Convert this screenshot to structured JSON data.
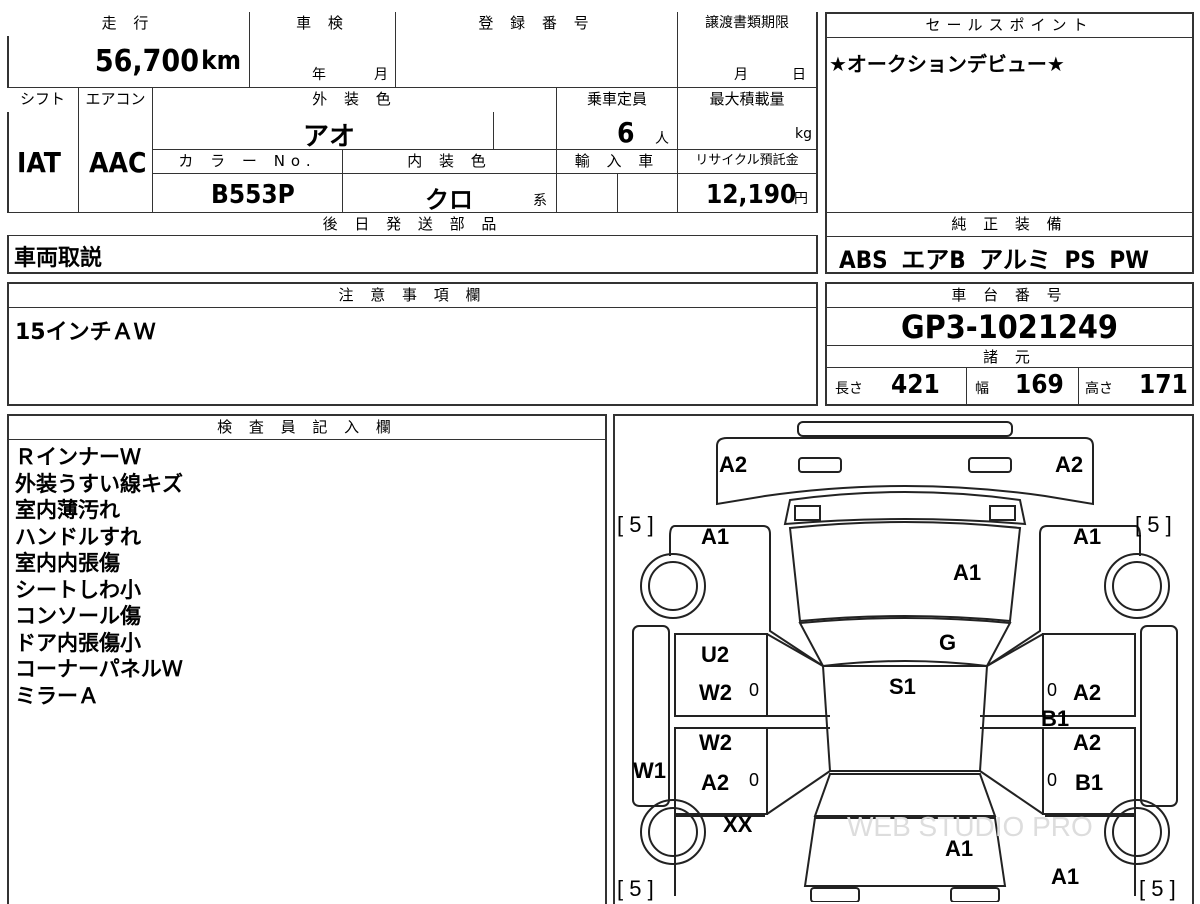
{
  "top": {
    "mileage_label": "走 行",
    "mileage_value": "56,700",
    "mileage_unit": "km",
    "shaken_label": "車 検",
    "shaken_year": "年",
    "shaken_month": "月",
    "reg_label": "登 録 番 号",
    "transfer_label": "譲渡書類期限",
    "transfer_month": "月",
    "transfer_day": "日",
    "shift_label": "シフト",
    "shift_value": "IAT",
    "ac_label": "エアコン",
    "ac_value": "AAC",
    "exterior_label": "外 装 色",
    "exterior_value": "アオ",
    "capacity_label": "乗車定員",
    "capacity_value": "6",
    "capacity_unit": "人",
    "maxload_label": "最大積載量",
    "maxload_unit": "kg",
    "color_no_label": "カ ラ ー No.",
    "color_no_value": "B553P",
    "interior_label": "内 装 色",
    "interior_value": "クロ",
    "interior_suffix": "系",
    "import_label": "輸 入 車",
    "recycle_label": "リサイクル預託金",
    "recycle_value": "12,190",
    "recycle_unit": "円",
    "later_parts_label": "後 日 発 送 部 品",
    "later_parts_value": "車両取説"
  },
  "sales": {
    "label": "セールスポイント",
    "value": "★オークションデビュー★"
  },
  "equipment": {
    "label": "純 正 装 備",
    "value": "ABS エアB アルミ PS PW"
  },
  "notes": {
    "label": "注 意 事 項 欄",
    "value": "15インチＡＷ"
  },
  "chassis": {
    "label": "車 台 番 号",
    "value": "GP3-1021249"
  },
  "specs": {
    "label": "諸 元",
    "length_label": "長さ",
    "length_value": "421",
    "width_label": "幅",
    "width_value": "169",
    "height_label": "高さ",
    "height_value": "171"
  },
  "inspector": {
    "label": "検 査 員 記 入 欄",
    "lines": [
      "ＲインナーＷ",
      "外装うすい線キズ",
      "室内薄汚れ",
      "ハンドルすれ",
      "室内内張傷",
      "シートしわ小",
      "コンソール傷",
      "ドア内張傷小",
      "コーナーパネルＷ",
      "ミラーＡ"
    ]
  },
  "diagram": {
    "tire_left_top": "[ 5 ]",
    "tire_right_top": "[ 5 ]",
    "tire_left_bottom": "[ 5 ]",
    "tire_right_bottom": "[ 5 ]",
    "marks": {
      "rear_left": "A2",
      "rear_right": "A2",
      "rear_fender_left": "A1",
      "rear_fender_right": "A1",
      "roof": "A1",
      "windshield": "G",
      "seat": "S1",
      "door_rl_top": "U2",
      "door_rl_mid": "W2",
      "door_rl_zero": "0",
      "door_fl_top": "W2",
      "door_fl_mid": "A2",
      "door_fl_zero": "0",
      "side_left": "W1",
      "front_left": "XX",
      "door_rr_zero": "0",
      "door_rr_top": "A2",
      "door_rr_b": "B1",
      "door_fr_top": "A2",
      "door_fr_zero": "0",
      "door_fr_b": "B1",
      "hood": "A1",
      "front_right": "A1"
    },
    "watermark": "WEB STUDIO PRO"
  }
}
